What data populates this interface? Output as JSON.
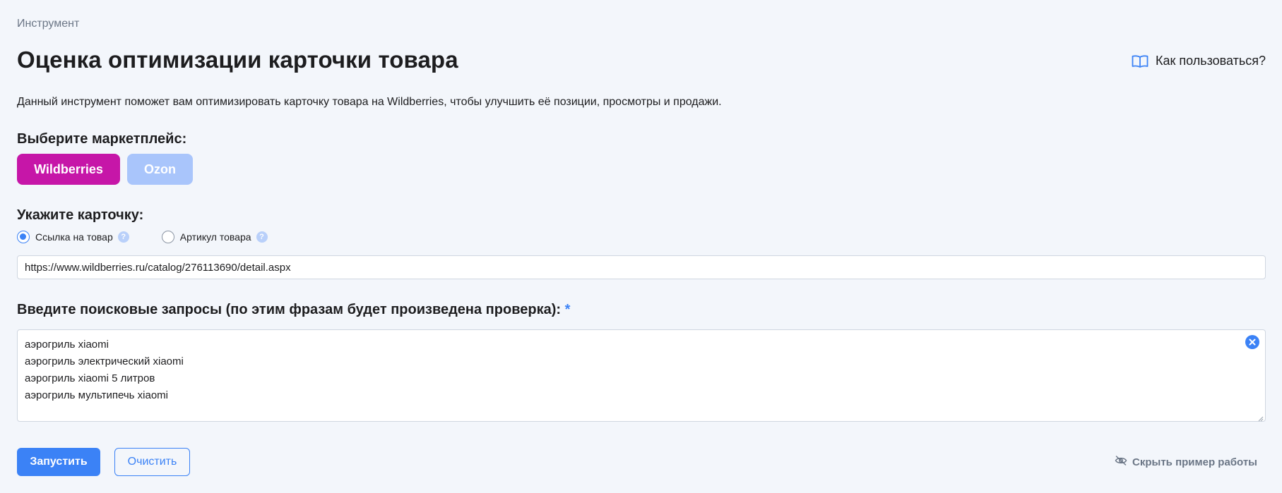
{
  "header": {
    "breadcrumb": "Инструмент",
    "title": "Оценка оптимизации карточки товара",
    "help_link": "Как пользоваться?",
    "description": "Данный инструмент поможет вам оптимизировать карточку товара на Wildberries, чтобы улучшить её позиции, просмотры и продажи."
  },
  "marketplace": {
    "label": "Выберите маркетплейс:",
    "options": [
      "Wildberries",
      "Ozon"
    ],
    "selected": "Wildberries",
    "colors": {
      "wildberries": "#c616a8",
      "ozon": "#a9c5fb"
    }
  },
  "card": {
    "label": "Укажите карточку:",
    "radio_link": "Ссылка на товар",
    "radio_article": "Артикул товара",
    "selected": "Ссылка на товар",
    "url_value": "https://www.wildberries.ru/catalog/276113690/detail.aspx"
  },
  "queries": {
    "label": "Введите поисковые запросы (по этим фразам будет произведена проверка):",
    "required_mark": "*",
    "lines": [
      "аэрогриль xiaomi",
      "аэрогриль электрический xiaomi",
      "аэрогриль xiaomi 5 литров",
      "аэрогриль мультипечь xiaomi"
    ]
  },
  "actions": {
    "run": "Запустить",
    "clear": "Очистить",
    "hide_example": "Скрыть пример работы"
  },
  "accent_color": "#3b82f6"
}
